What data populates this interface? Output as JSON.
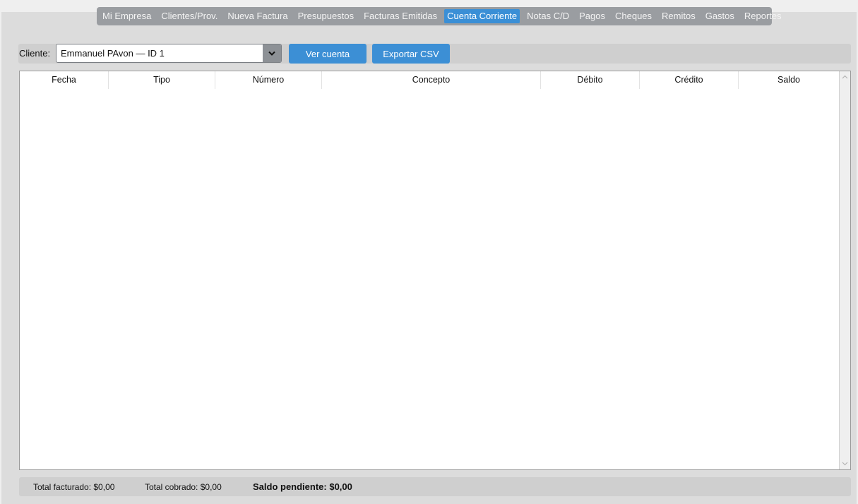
{
  "tabs": [
    {
      "label": "Mi Empresa",
      "active": false
    },
    {
      "label": "Clientes/Prov.",
      "active": false
    },
    {
      "label": "Nueva Factura",
      "active": false
    },
    {
      "label": "Presupuestos",
      "active": false
    },
    {
      "label": "Facturas Emitidas",
      "active": false
    },
    {
      "label": "Cuenta Corriente",
      "active": true
    },
    {
      "label": "Notas C/D",
      "active": false
    },
    {
      "label": "Pagos",
      "active": false
    },
    {
      "label": "Cheques",
      "active": false
    },
    {
      "label": "Remitos",
      "active": false
    },
    {
      "label": "Gastos",
      "active": false
    },
    {
      "label": "Reportes",
      "active": false
    }
  ],
  "toolbar": {
    "client_label": "Cliente:",
    "client_selected": "Emmanuel PAvon — ID 1",
    "view_button": "Ver cuenta",
    "export_button": "Exportar CSV"
  },
  "table": {
    "columns": [
      "Fecha",
      "Tipo",
      "Número",
      "Concepto",
      "Débito",
      "Crédito",
      "Saldo"
    ],
    "rows": []
  },
  "footer": {
    "total_facturado": "Total facturado: $0,00",
    "total_cobrado": "Total cobrado: $0,00",
    "saldo_pendiente": "Saldo pendiente: $0,00"
  },
  "colors": {
    "accent": "#3c8fd5",
    "tab_active": "#3a8fd6",
    "tab_bar": "#9a9da1"
  },
  "icons": {
    "dropdown": "chevron-down-icon",
    "scroll_up": "scroll-up-arrow-icon",
    "scroll_down": "scroll-down-arrow-icon"
  }
}
